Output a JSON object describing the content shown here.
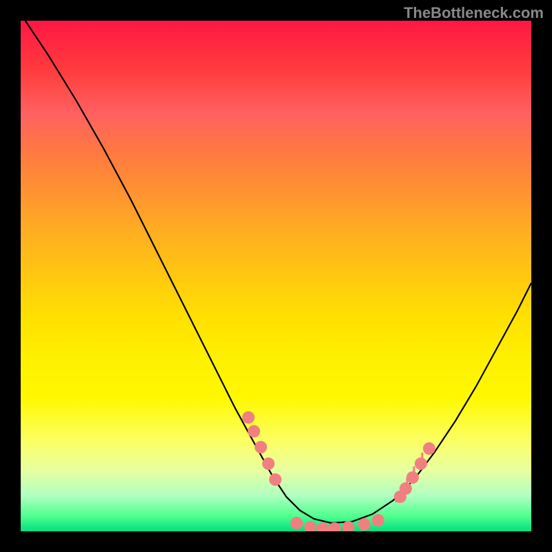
{
  "watermark": "TheBottleneck.com",
  "colors": {
    "background": "#000000",
    "curve": "#000000",
    "marker": "#f08080"
  },
  "chart_data": {
    "type": "line",
    "title": "",
    "xlabel": "",
    "ylabel": "",
    "xlim": [
      0,
      740
    ],
    "ylim": [
      0,
      740
    ],
    "grid": false,
    "legend": false,
    "curve_points": [
      {
        "x": 0,
        "y": -10
      },
      {
        "x": 40,
        "y": 50
      },
      {
        "x": 80,
        "y": 115
      },
      {
        "x": 120,
        "y": 185
      },
      {
        "x": 160,
        "y": 260
      },
      {
        "x": 200,
        "y": 340
      },
      {
        "x": 240,
        "y": 420
      },
      {
        "x": 280,
        "y": 500
      },
      {
        "x": 310,
        "y": 560
      },
      {
        "x": 340,
        "y": 615
      },
      {
        "x": 365,
        "y": 660
      },
      {
        "x": 385,
        "y": 690
      },
      {
        "x": 405,
        "y": 710
      },
      {
        "x": 425,
        "y": 722
      },
      {
        "x": 450,
        "y": 728
      },
      {
        "x": 480,
        "y": 726
      },
      {
        "x": 510,
        "y": 715
      },
      {
        "x": 540,
        "y": 695
      },
      {
        "x": 570,
        "y": 665
      },
      {
        "x": 600,
        "y": 625
      },
      {
        "x": 630,
        "y": 580
      },
      {
        "x": 660,
        "y": 530
      },
      {
        "x": 690,
        "y": 475
      },
      {
        "x": 720,
        "y": 420
      },
      {
        "x": 740,
        "y": 380
      }
    ],
    "markers_left": [
      {
        "x": 330,
        "y": 575
      },
      {
        "x": 338,
        "y": 595
      },
      {
        "x": 348,
        "y": 618
      },
      {
        "x": 359,
        "y": 642
      },
      {
        "x": 369,
        "y": 665
      }
    ],
    "markers_bottom": [
      {
        "x": 400,
        "y": 728
      },
      {
        "x": 420,
        "y": 734
      },
      {
        "x": 438,
        "y": 736
      },
      {
        "x": 455,
        "y": 736
      },
      {
        "x": 475,
        "y": 734
      },
      {
        "x": 498,
        "y": 730
      },
      {
        "x": 518,
        "y": 724
      }
    ],
    "markers_right": [
      {
        "x": 550,
        "y": 690
      },
      {
        "x": 558,
        "y": 678
      },
      {
        "x": 568,
        "y": 662
      },
      {
        "x": 580,
        "y": 642
      },
      {
        "x": 592,
        "y": 620
      }
    ],
    "ticks_right": [
      {
        "x": 544,
        "y": 698
      },
      {
        "x": 552,
        "y": 688
      },
      {
        "x": 560,
        "y": 676
      },
      {
        "x": 570,
        "y": 660
      },
      {
        "x": 582,
        "y": 640
      }
    ]
  }
}
